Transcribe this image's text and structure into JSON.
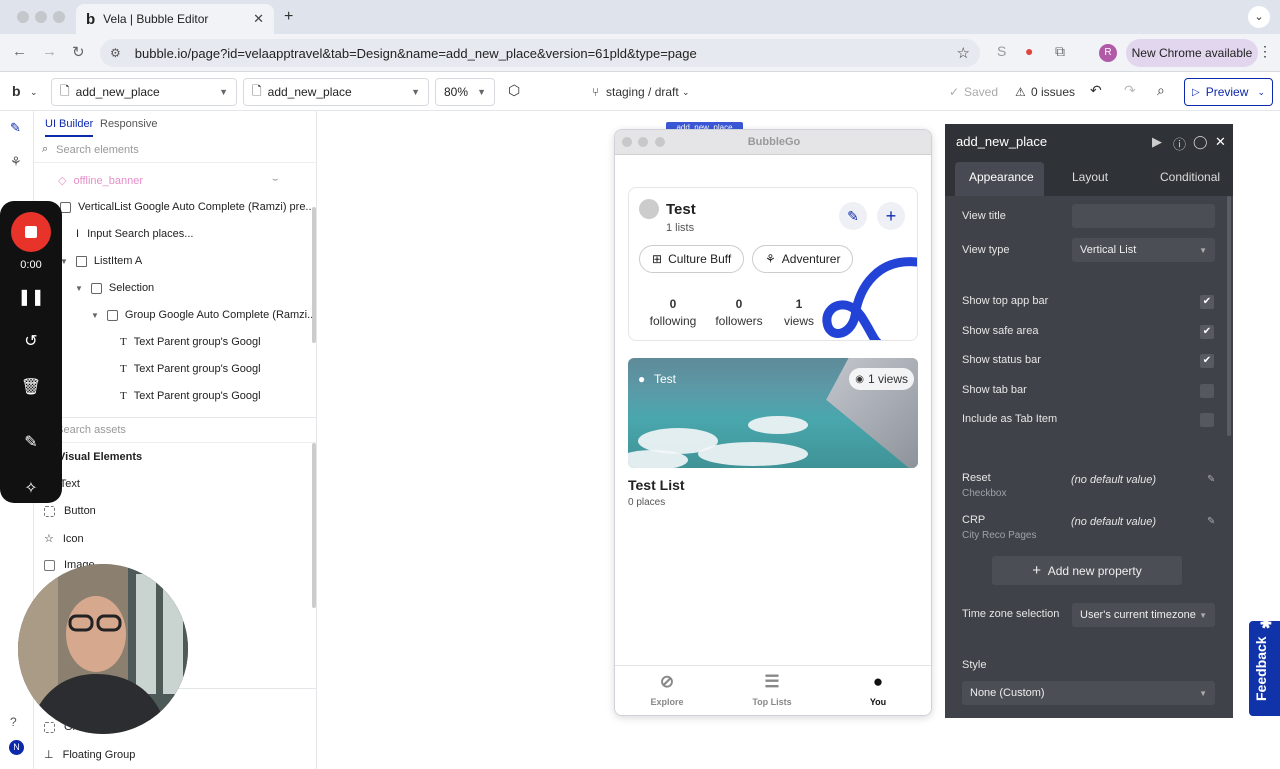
{
  "browser": {
    "tab_title": "Vela | Bubble Editor",
    "url": "bubble.io/page?id=velaapptravel&tab=Design&name=add_new_place&version=61pld&type=page",
    "new_chrome": "New Chrome available",
    "profile_initial": "R"
  },
  "header": {
    "page_select_1": "add_new_place",
    "page_select_2": "add_new_place",
    "zoom": "80%",
    "branch": "staging / draft",
    "saved": "Saved",
    "issues": "0 issues",
    "preview": "Preview"
  },
  "left_panel": {
    "tab_ui_builder": "UI Builder",
    "tab_responsive": "Responsive",
    "search_elements_placeholder": "Search elements",
    "tree": [
      "offline_banner",
      "VerticalList Google Auto Complete (Ramzi) pre...",
      "Input Search places...",
      "ListItem A",
      "Selection",
      "Group Google Auto Complete (Ramzi...",
      "Text Parent group's Googl",
      "Text Parent group's Googl",
      "Text Parent group's Googl"
    ],
    "search_assets_placeholder": "Search assets",
    "visual_elements_title": "Visual Elements",
    "visual_elements": [
      "Text",
      "Button",
      "Icon",
      "Image"
    ],
    "bottom_items": [
      "Group",
      "Floating Group"
    ]
  },
  "recorder": {
    "time": "0:00"
  },
  "phone": {
    "page_label": "add_new_place",
    "title": "BubbleGo",
    "profile_name": "Test",
    "profile_lists": "1 lists",
    "chip1": "Culture Buff",
    "chip2": "Adventurer",
    "stats": [
      {
        "value": "0",
        "label": "following"
      },
      {
        "value": "0",
        "label": "followers"
      },
      {
        "value": "1",
        "label": "views"
      }
    ],
    "card_user": "Test",
    "card_views": "1 views",
    "list_title": "Test List",
    "list_places": "0 places",
    "nav": [
      "Explore",
      "Top Lists",
      "You"
    ]
  },
  "property_panel": {
    "title": "add_new_place",
    "tabs": [
      "Appearance",
      "Layout",
      "Conditional"
    ],
    "view_title_label": "View title",
    "view_type_label": "View type",
    "view_type_value": "Vertical List",
    "checkboxes": [
      {
        "label": "Show top app bar",
        "checked": true
      },
      {
        "label": "Show safe area",
        "checked": true
      },
      {
        "label": "Show status bar",
        "checked": true
      },
      {
        "label": "Show tab bar",
        "checked": false
      },
      {
        "label": "Include as Tab Item",
        "checked": false
      }
    ],
    "reset_label": "Reset",
    "reset_sub": "Checkbox",
    "reset_value": "(no default value)",
    "crp_label": "CRP",
    "crp_sub": "City Reco Pages",
    "crp_value": "(no default value)",
    "add_property": "Add new property",
    "tz_label": "Time zone selection",
    "tz_value": "User's current timezone",
    "style_label": "Style",
    "style_value": "None (Custom)"
  },
  "feedback": "Feedback"
}
